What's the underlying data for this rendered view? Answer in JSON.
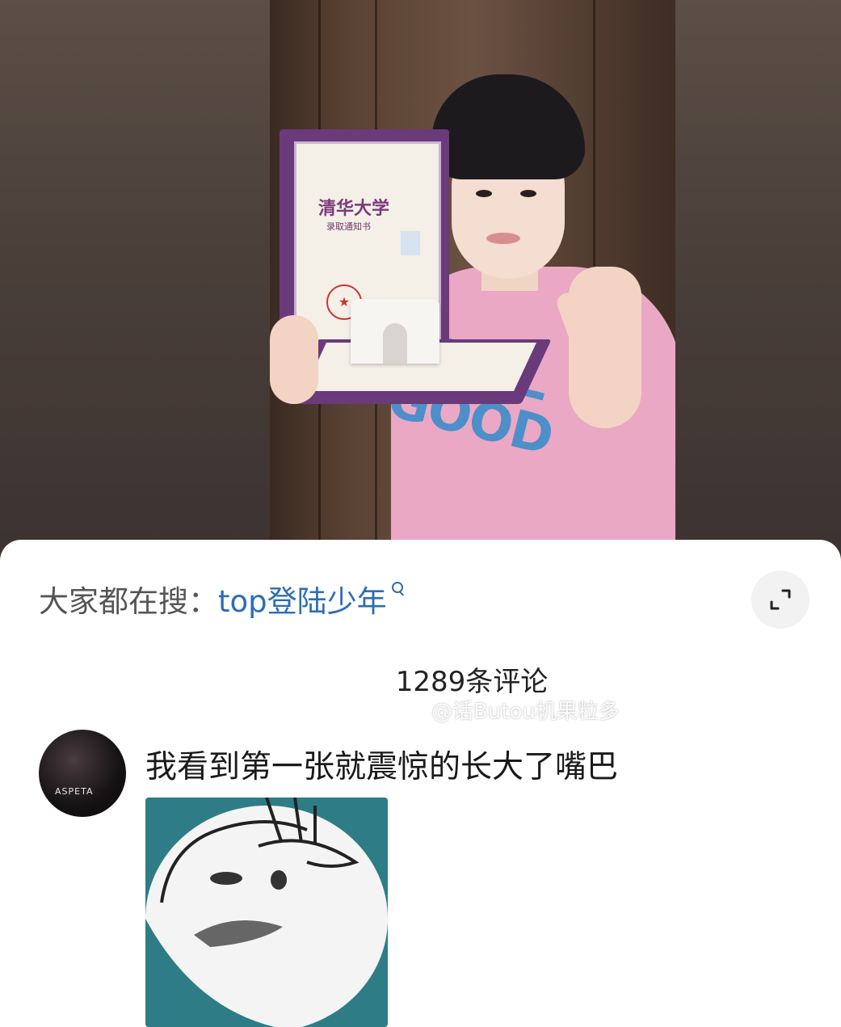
{
  "search": {
    "prefix": "大家都在搜：",
    "term": "top登陆少年"
  },
  "comments": {
    "count_label": "1289条评论",
    "items": [
      {
        "text": "我看到第一张就震惊的长大了嘴巴",
        "avatar_text": "ASPETA"
      }
    ]
  },
  "watermark": {
    "text": "@话Butou机果粒多"
  },
  "photo": {
    "certificate_title": "清华大学",
    "certificate_subtitle": "录取通知书",
    "shirt_print": "STILL GOOD"
  },
  "colors": {
    "link": "#2d6db5",
    "meme_background": "#2e7d86",
    "shirt": "#eba8c4"
  }
}
